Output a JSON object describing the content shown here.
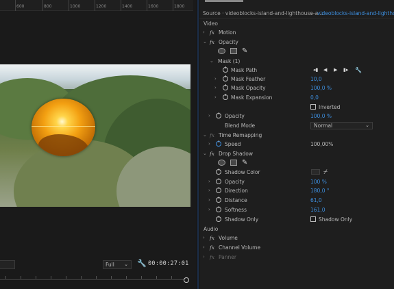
{
  "timeline_ruler": {
    "ticks": [
      "600",
      "800",
      "1000",
      "1200",
      "1400",
      "1600",
      "1800"
    ]
  },
  "monitor": {
    "resolution": "Full",
    "timecode": "00:00:27:01"
  },
  "source": {
    "label": "Source · videoblocks-island-and-lighthouse-a...",
    "clip": "videoblocks-island-and-lighthouse"
  },
  "video_section": "Video",
  "audio_section": "Audio",
  "effects": {
    "motion": "Motion",
    "opacity": "Opacity",
    "mask": "Mask (1)",
    "mask_path": "Mask Path",
    "mask_feather": {
      "label": "Mask Feather",
      "value": "10,0"
    },
    "mask_opacity": {
      "label": "Mask Opacity",
      "value": "100,0 %"
    },
    "mask_expansion": {
      "label": "Mask Expansion",
      "value": "0,0"
    },
    "inverted": "Inverted",
    "opacity_param": {
      "label": "Opacity",
      "value": "100,0 %"
    },
    "blend_mode": {
      "label": "Blend Mode",
      "value": "Normal"
    },
    "time_remapping": "Time Remapping",
    "speed": {
      "label": "Speed",
      "value": "100,00%"
    },
    "drop_shadow": "Drop Shadow",
    "shadow_color": "Shadow Color",
    "ds_opacity": {
      "label": "Opacity",
      "value": "100 %"
    },
    "direction": {
      "label": "Direction",
      "value": "180,0 °"
    },
    "distance": {
      "label": "Distance",
      "value": "61,0"
    },
    "softness": {
      "label": "Softness",
      "value": "161,0"
    },
    "shadow_only": {
      "label": "Shadow Only",
      "checkbox": "Shadow Only"
    },
    "volume": "Volume",
    "channel_volume": "Channel Volume",
    "panner": "Panner"
  },
  "colors": {
    "accent": "#3d8fe0",
    "background": "#1e1e1e"
  }
}
